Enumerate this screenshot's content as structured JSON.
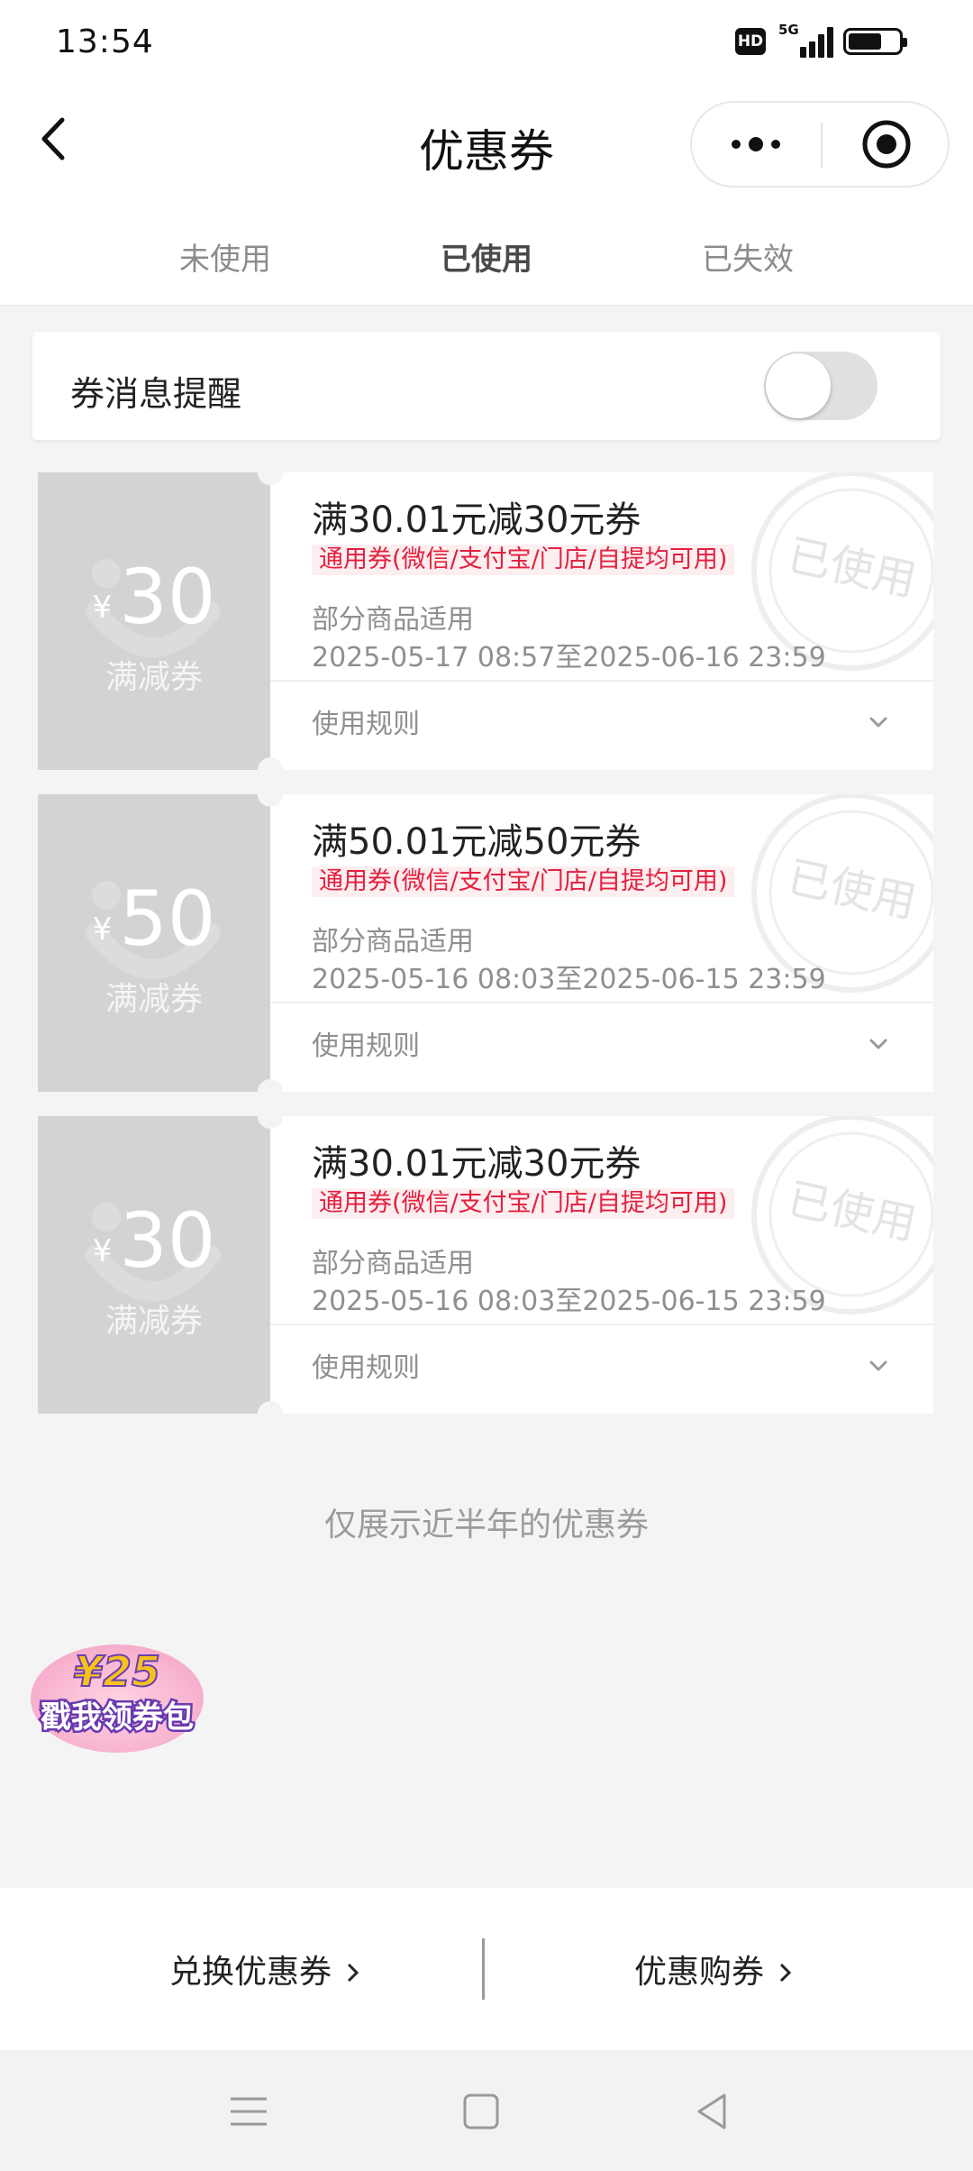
{
  "status_bar": {
    "time": "13:54",
    "hd": "HD",
    "network": "5G"
  },
  "nav": {
    "title": "优惠券"
  },
  "tabs": [
    {
      "label": "未使用",
      "active": false
    },
    {
      "label": "已使用",
      "active": true
    },
    {
      "label": "已失效",
      "active": false
    }
  ],
  "reminder": {
    "label": "券消息提醒",
    "enabled": false
  },
  "coupons": [
    {
      "currency": "¥",
      "amount": "30",
      "type": "满减券",
      "title": "满30.01元减30元券",
      "tag": "通用券(微信/支付宝/门店/自提均可用)",
      "scope": "部分商品适用",
      "validity": "2025-05-17 08:57至2025-06-16 23:59",
      "rules_label": "使用规则",
      "stamp": "已使用"
    },
    {
      "currency": "¥",
      "amount": "50",
      "type": "满减券",
      "title": "满50.01元减50元券",
      "tag": "通用券(微信/支付宝/门店/自提均可用)",
      "scope": "部分商品适用",
      "validity": "2025-05-16 08:03至2025-06-15 23:59",
      "rules_label": "使用规则",
      "stamp": "已使用"
    },
    {
      "currency": "¥",
      "amount": "30",
      "type": "满减券",
      "title": "满30.01元减30元券",
      "tag": "通用券(微信/支付宝/门店/自提均可用)",
      "scope": "部分商品适用",
      "validity": "2025-05-16 08:03至2025-06-15 23:59",
      "rules_label": "使用规则",
      "stamp": "已使用"
    }
  ],
  "footer_note": "仅展示近半年的优惠券",
  "promo": {
    "amount": "¥25",
    "label": "戳我领券包"
  },
  "bottom_actions": {
    "redeem": "兑换优惠券",
    "buy": "优惠购券"
  },
  "colors": {
    "accent_red": "#e3203e",
    "coupon_gray": "#d3d3d3",
    "background": "#f4f4f4"
  }
}
